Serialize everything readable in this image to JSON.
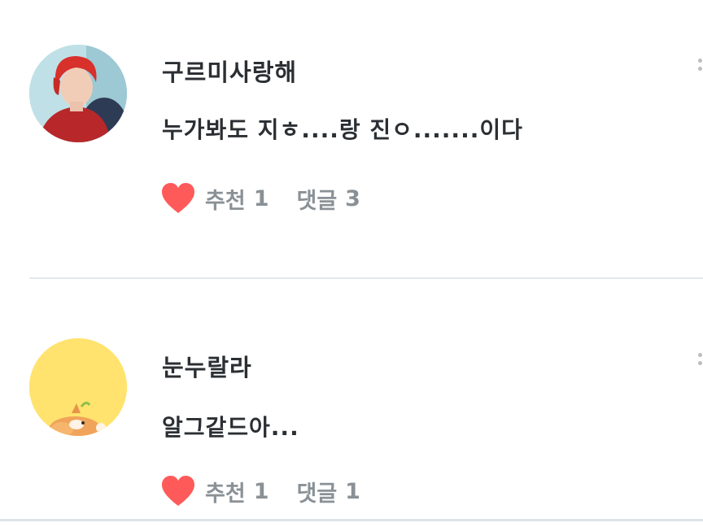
{
  "comments": [
    {
      "author": "구르미사랑해",
      "text": "누가봐도 지ㅎ....랑 진ㅇ.......이다",
      "like_label": "추천",
      "like_count": "1",
      "reply_label": "댓글",
      "reply_count": "3",
      "avatar": "photo-avatar"
    },
    {
      "author": "눈누랄라",
      "text": "알그같드아...",
      "like_label": "추천",
      "like_count": "1",
      "reply_label": "댓글",
      "reply_count": "1",
      "avatar": "cartoon-avatar"
    }
  ],
  "colors": {
    "heart": "#ff5a5a",
    "meta_text": "#8a9196",
    "body_text": "#2b2f33",
    "divider": "#e6e9ec"
  }
}
